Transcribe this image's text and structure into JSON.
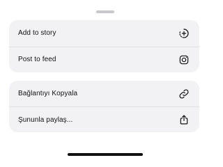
{
  "share_sheet": {
    "groups": [
      {
        "items": [
          {
            "label": "Add to story",
            "icon": "add-story-icon"
          },
          {
            "label": "Post to feed",
            "icon": "instagram-icon"
          }
        ]
      },
      {
        "items": [
          {
            "label": "Bağlantıyı Kopyala",
            "icon": "link-icon"
          },
          {
            "label": "Şununla paylaş...",
            "icon": "share-icon"
          }
        ]
      }
    ]
  },
  "colors": {
    "background": "#ffffff",
    "group_background": "#f2f2f4",
    "text": "#111111",
    "divider": "#e1e1e5",
    "grabber": "#c7c7cc"
  }
}
